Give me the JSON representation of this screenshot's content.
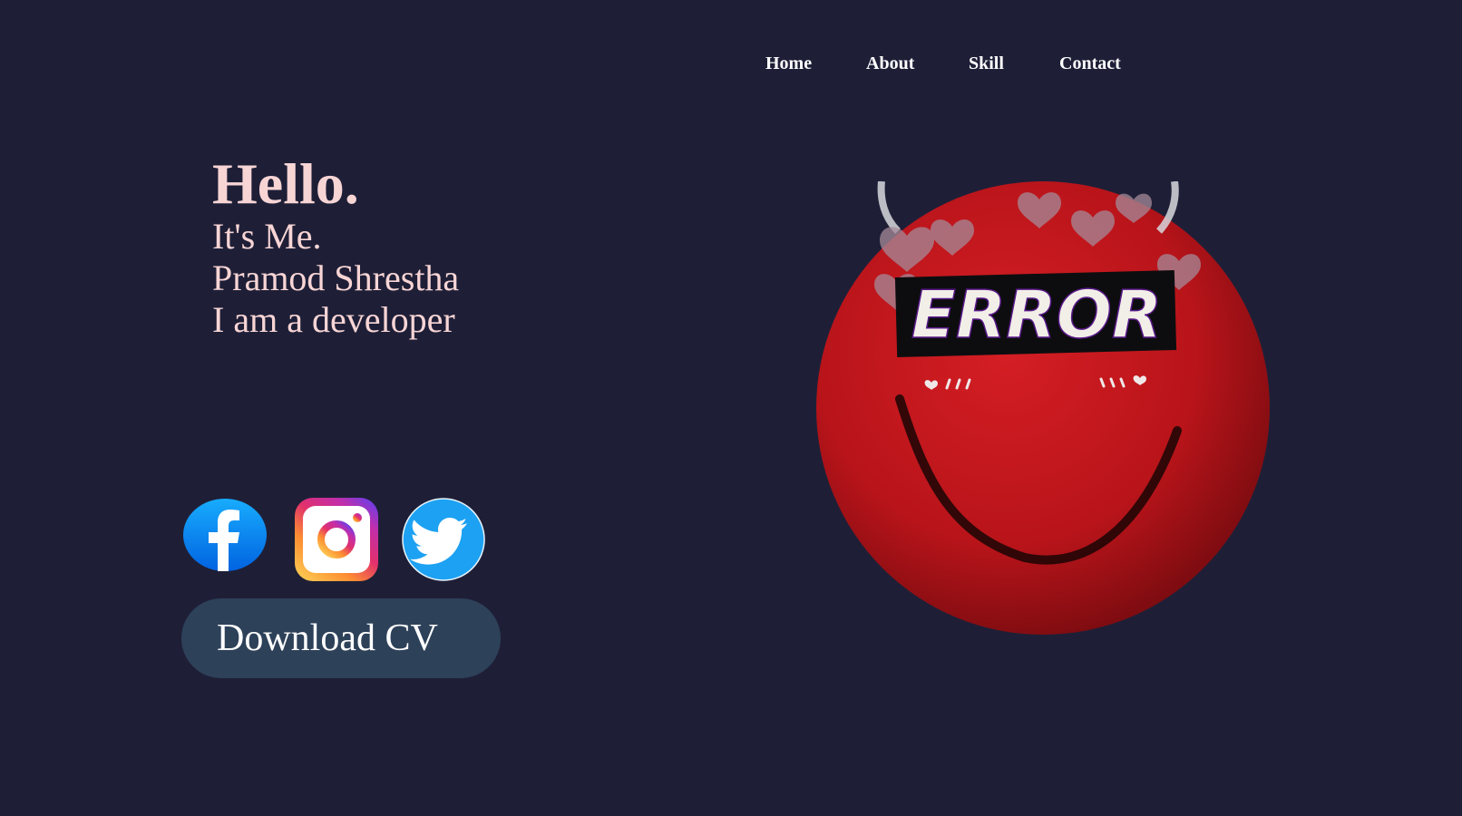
{
  "nav": {
    "items": [
      {
        "label": "Home"
      },
      {
        "label": "About"
      },
      {
        "label": "Skill"
      },
      {
        "label": "Contact"
      }
    ]
  },
  "intro": {
    "greeting": "Hello.",
    "line1": "It's Me.",
    "name": "Pramod Shrestha",
    "role": "I am a developer"
  },
  "social": [
    {
      "icon": "facebook-icon",
      "color": "#1877f2"
    },
    {
      "icon": "instagram-icon",
      "color": "#e1306c"
    },
    {
      "icon": "twitter-icon",
      "color": "#1da1f2"
    }
  ],
  "cta": {
    "download_label": "Download CV"
  },
  "avatar": {
    "badge_text": "ERROR"
  },
  "colors": {
    "background": "#1e1f37",
    "accent_text": "#f8d5d5",
    "button_bg": "#2d4159",
    "avatar_red": "#d11a1a"
  }
}
